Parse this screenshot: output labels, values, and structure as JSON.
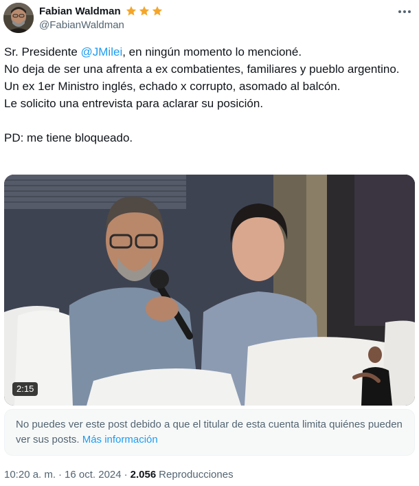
{
  "header": {
    "display_name": "Fabian Waldman",
    "handle": "@FabianWaldman",
    "stars": [
      "star-icon",
      "star-icon",
      "star-icon"
    ],
    "star_color": "#f4a62a"
  },
  "tweet": {
    "line1_prefix": "Sr. Presidente ",
    "mention": "@JMilei",
    "line1_suffix": ", en ningún momento lo mencioné.",
    "line2": "No deja de ser una afrenta a ex combatientes, familiares y pueblo argentino. Un ex 1er Ministro inglés, echado x corrupto, asomado al balcón.",
    "line3": "Le solicito una entrevista para aclarar su posición.",
    "line4": "PD: me tiene bloqueado.",
    "mention_color": "#1d9bf0"
  },
  "media": {
    "duration": "2:15"
  },
  "notice": {
    "text": "No puedes ver este post debido a que el titular de esta cuenta limita quiénes pueden ver sus posts. ",
    "link": "Más información"
  },
  "meta": {
    "time": "10:20 a. m.",
    "separator1": "·",
    "date": "16 oct. 2024",
    "separator2": "·",
    "views_count": "2.056",
    "views_label": "Reproducciones"
  }
}
